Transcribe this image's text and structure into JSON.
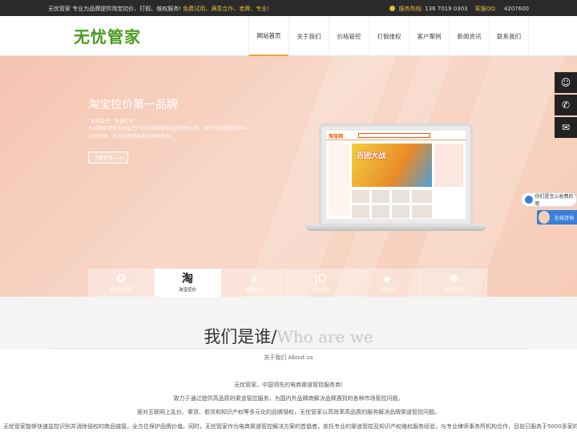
{
  "topbar": {
    "intro": "无忧管家 专业为品牌提供淘宝控价、打假、维权服务!",
    "promo": "免费试用、满意合作、老牌、专业!",
    "hotline_label": "服务热线:",
    "hotline": "136 7019 0303",
    "qq_label": "客服QQ:",
    "qq": "4207600"
  },
  "header": {
    "logo": "无忧管家",
    "nav": [
      "网站首页",
      "关于我们",
      "价格管控",
      "打假维权",
      "客户案例",
      "新闻资讯",
      "联系我们"
    ]
  },
  "banner": {
    "title": "淘宝控价第一品牌",
    "quote": "\"全网监控、快速打击\"",
    "desc": "为品牌商提供实时监控产品在各网络渠道的销售价格，提升市场营销效率与及时反馈，有效监管网络渠道价格体系!",
    "more": "了解更多 >>",
    "laptop": {
      "site_logo": "淘宝网",
      "hero": "百团大战"
    },
    "tabs": [
      {
        "icon": "medal-icon",
        "glyph": "✪",
        "label": "我们的优势"
      },
      {
        "icon": "taobao-icon",
        "glyph": "淘",
        "label": "淘宝控价"
      },
      {
        "icon": "alibaba-icon",
        "glyph": "a",
        "label": "阿里控价"
      },
      {
        "icon": "jd-icon",
        "glyph": "JD",
        "label": "京东控价"
      },
      {
        "icon": "stack-icon",
        "glyph": "◈",
        "label": "打假维权"
      },
      {
        "icon": "aperture-icon",
        "glyph": "✺",
        "label": "成功案例"
      }
    ]
  },
  "side": {
    "qq_glyph": "☺",
    "phone_glyph": "✆",
    "wechat_glyph": "✉",
    "chat_bubble": "你们是怎么收费的呢",
    "online": "在线咨询"
  },
  "about": {
    "title_cn": "我们是谁/",
    "title_en": "Who are we",
    "sub": "关于我们 About us",
    "p1": "无忧管家，中国领先的电商渠道管控服务商!",
    "p2": "致力于通过提供高品质的渠道管控服务，为国内外品牌商解决品牌遇到的各种市场管控问题。",
    "p3": "面对互联网上乱价、窜货、假货和知识产权等多元化的品牌侵权，无忧管家以高效率高品质的服务解决品牌渠道管控问题。",
    "p4": "无忧管家能够快速监控识别并消除侵权的商品链接，全方位保护品牌价值。同时，无忧管家作为电商渠道管控解决方案的首倡者，依托专业的渠道管控及知识产权维权服务经验，与专业律师事务所机构合作，目前已服务于5000多家的"
  },
  "colors": {
    "logo_green": "#4a9a1e",
    "accent_yellow": "#e8b83c",
    "banner_peach": "#f6ccb8",
    "online_blue": "#3b7fd8"
  }
}
